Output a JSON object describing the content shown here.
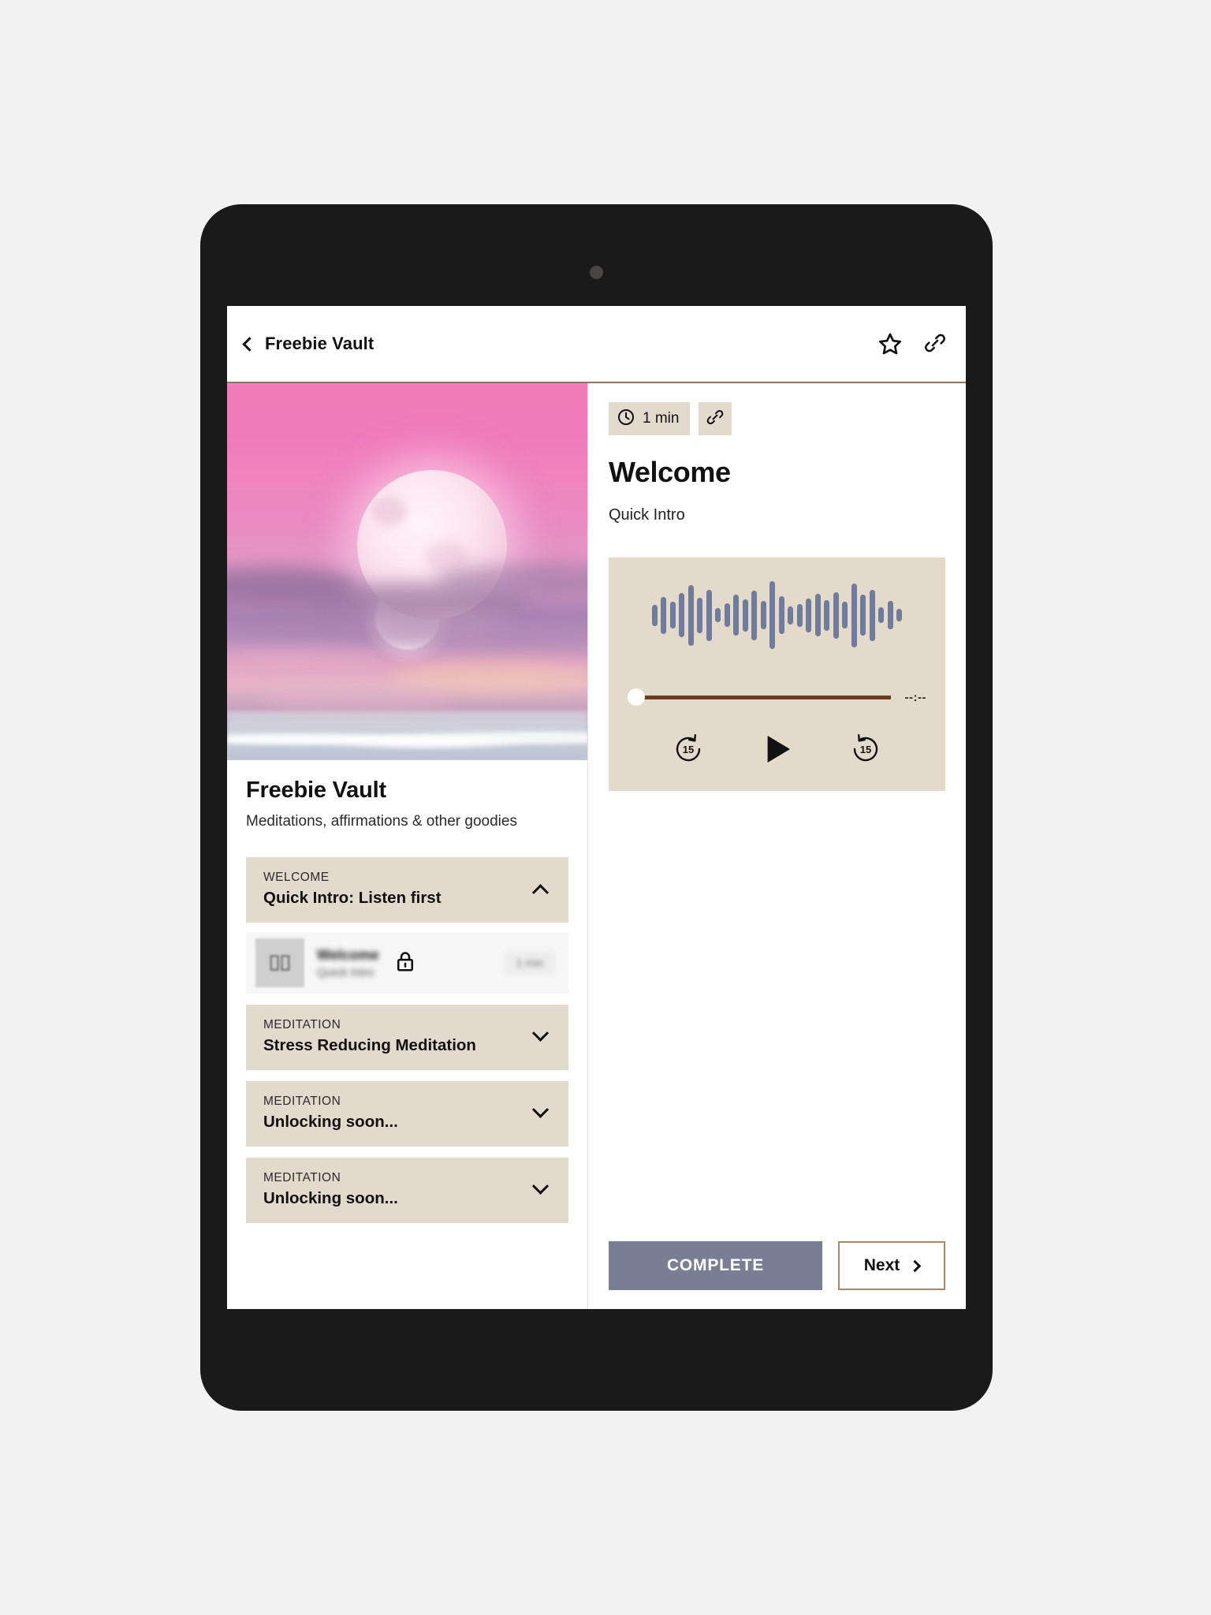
{
  "app_bar": {
    "back_icon": "chevron-left-icon",
    "title": "Freebie Vault",
    "star_icon": "star-icon",
    "link_icon": "link-icon"
  },
  "sidebar": {
    "hero_image_alt": "pink sunset sky with large moon over ocean",
    "course_title": "Freebie Vault",
    "course_subtitle": "Meditations, affirmations & other goodies",
    "sections": [
      {
        "kicker": "WELCOME",
        "title": "Quick Intro: Listen first",
        "chevron": "chevron-up-icon",
        "expanded": true
      },
      {
        "kicker": "MEDITATION",
        "title": "Stress Reducing Meditation",
        "chevron": "chevron-down-icon",
        "expanded": false
      },
      {
        "kicker": "MEDITATION",
        "title": "Unlocking soon...",
        "chevron": "chevron-down-icon",
        "expanded": false
      },
      {
        "kicker": "MEDITATION",
        "title": "Unlocking soon...",
        "chevron": "chevron-down-icon",
        "expanded": false
      }
    ],
    "lesson_row": {
      "thumb_icon": "book-icon",
      "title": "Welcome",
      "subtitle": "Quick Intro",
      "lock_icon": "lock-icon",
      "duration": "1 min"
    }
  },
  "lesson": {
    "duration_chip": {
      "icon": "clock-icon",
      "text": "1 min"
    },
    "link_chip_icon": "link-icon",
    "heading": "Welcome",
    "subheading": "Quick Intro"
  },
  "player": {
    "waveform_icon": "audio-waveform",
    "progress_percent": 0,
    "time_label": "--:--",
    "rewind_label": "15",
    "rewind_icon": "rewind-15-icon",
    "play_icon": "play-icon",
    "forward_label": "15",
    "forward_icon": "forward-15-icon",
    "waveform_values": [
      30,
      52,
      38,
      62,
      86,
      50,
      72,
      20,
      34,
      58,
      46,
      70,
      40,
      96,
      54,
      26,
      32,
      48,
      60,
      44,
      66,
      38,
      90,
      58,
      72,
      22,
      40,
      18
    ]
  },
  "footer": {
    "complete_label": "COMPLETE",
    "next_label": "Next",
    "next_icon": "chevron-right-icon"
  },
  "colors": {
    "tan": "#e2dacd",
    "player_bg": "#e3dacb",
    "waveform": "#717b9b",
    "progress": "#6b3f20",
    "complete_bg": "#787e94",
    "next_border": "#a9886b",
    "divider": "#8a7567"
  }
}
